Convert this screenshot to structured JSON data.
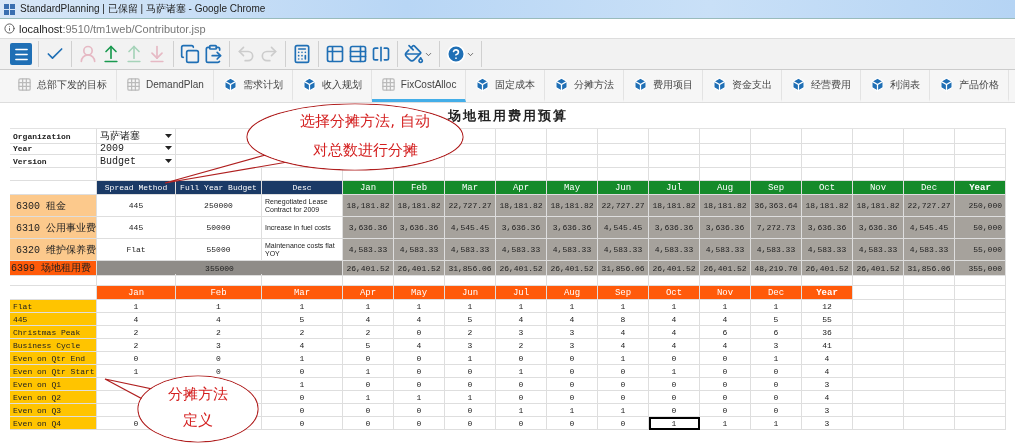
{
  "browser": {
    "title": "StandardPlanning | 已保留 | 马萨诸塞 - Google Chrome",
    "url_host": "localhost",
    "url_path": ":9510/tm1web/Contributor.jsp"
  },
  "toolbar": {
    "groups": [
      [
        {
          "kind": "menu",
          "disabled": false
        }
      ],
      [
        {
          "kind": "check",
          "disabled": false
        }
      ],
      [
        {
          "kind": "user",
          "disabled": true
        },
        {
          "kind": "upload",
          "disabled": false
        },
        {
          "kind": "upload",
          "disabled": true
        },
        {
          "kind": "download",
          "disabled": true
        }
      ],
      [
        {
          "kind": "copy",
          "disabled": false
        },
        {
          "kind": "paste",
          "disabled": false
        }
      ],
      [
        {
          "kind": "undo",
          "disabled": true
        },
        {
          "kind": "redo",
          "disabled": true
        }
      ],
      [
        {
          "kind": "calculator",
          "disabled": false
        }
      ],
      [
        {
          "kind": "table",
          "disabled": false
        },
        {
          "kind": "table-edit",
          "disabled": false
        },
        {
          "kind": "split",
          "disabled": false
        }
      ],
      [
        {
          "kind": "bucket",
          "disabled": false
        }
      ],
      [
        {
          "kind": "help",
          "disabled": false
        }
      ]
    ]
  },
  "tabs": [
    {
      "label": "总部下发的目标",
      "kind": "grid",
      "selected": false
    },
    {
      "label": "DemandPlan",
      "kind": "grid",
      "selected": false
    },
    {
      "label": "需求计划",
      "kind": "cube",
      "selected": false
    },
    {
      "label": "收入规划",
      "kind": "cube",
      "selected": false
    },
    {
      "label": "FixCostAlloc",
      "kind": "grid",
      "selected": true
    },
    {
      "label": "固定成本",
      "kind": "cube",
      "selected": false
    },
    {
      "label": "分摊方法",
      "kind": "cube",
      "selected": false
    },
    {
      "label": "费用项目",
      "kind": "cube",
      "selected": false
    },
    {
      "label": "资金支出",
      "kind": "cube",
      "selected": false
    },
    {
      "label": "经营费用",
      "kind": "cube",
      "selected": false
    },
    {
      "label": "利润表",
      "kind": "cube",
      "selected": false
    },
    {
      "label": "产品价格",
      "kind": "cube",
      "selected": false
    }
  ],
  "sheet": {
    "title": "场地租用费用预算",
    "filters": [
      {
        "label": "Organization",
        "value": "马萨诸塞"
      },
      {
        "label": "Year",
        "value": "2009"
      },
      {
        "label": "Version",
        "value": "Budget"
      }
    ],
    "budget_table": {
      "columns": [
        "Spread Method",
        "Full Year Budget",
        "Desc",
        "Jan",
        "Feb",
        "Mar",
        "Apr",
        "May",
        "Jun",
        "Jul",
        "Aug",
        "Sep",
        "Oct",
        "Nov",
        "Dec",
        "Year"
      ],
      "rows": [
        {
          "label": "6300 租金",
          "method": "445",
          "budget": "250000",
          "desc": "Renegotiated Lease Contract for 2009",
          "values": [
            "18,181.82",
            "18,181.82",
            "22,727.27",
            "18,181.82",
            "18,181.82",
            "22,727.27",
            "18,181.82",
            "18,181.82",
            "36,363.64",
            "18,181.82",
            "18,181.82",
            "22,727.27",
            "250,000"
          ]
        },
        {
          "label": "6310 公用事业费",
          "method": "445",
          "budget": "50000",
          "desc": "Increase in fuel costs",
          "values": [
            "3,636.36",
            "3,636.36",
            "4,545.45",
            "3,636.36",
            "3,636.36",
            "4,545.45",
            "3,636.36",
            "3,636.36",
            "7,272.73",
            "3,636.36",
            "3,636.36",
            "4,545.45",
            "50,000"
          ]
        },
        {
          "label": "6320 维护保养费",
          "method": "Flat",
          "budget": "55000",
          "desc": "Maintenance costs flat YOY",
          "values": [
            "4,583.33",
            "4,583.33",
            "4,583.33",
            "4,583.33",
            "4,583.33",
            "4,583.33",
            "4,583.33",
            "4,583.33",
            "4,583.33",
            "4,583.33",
            "4,583.33",
            "4,583.33",
            "55,000"
          ]
        }
      ],
      "total": {
        "label": "6399 场地租用费",
        "budget": "355000",
        "values": [
          "26,401.52",
          "26,401.52",
          "31,856.06",
          "26,401.52",
          "26,401.52",
          "31,856.06",
          "26,401.52",
          "26,401.52",
          "48,219.70",
          "26,401.52",
          "26,401.52",
          "31,856.06",
          "355,000"
        ]
      }
    },
    "spread_table": {
      "columns": [
        "Jan",
        "Feb",
        "Mar",
        "Apr",
        "May",
        "Jun",
        "Jul",
        "Aug",
        "Sep",
        "Oct",
        "Nov",
        "Dec",
        "Year"
      ],
      "rows": [
        {
          "label": "Flat",
          "cells": [
            {
              "text": "1",
              "selected": false
            },
            {
              "text": "1",
              "selected": false
            },
            {
              "text": "1",
              "selected": false
            },
            {
              "text": "1",
              "selected": false
            },
            {
              "text": "1",
              "selected": false
            },
            {
              "text": "1",
              "selected": false
            },
            {
              "text": "1",
              "selected": false
            },
            {
              "text": "1",
              "selected": false
            },
            {
              "text": "1",
              "selected": false
            },
            {
              "text": "1",
              "selected": false
            },
            {
              "text": "1",
              "selected": false
            },
            {
              "text": "1",
              "selected": false
            },
            {
              "text": "12",
              "selected": false
            }
          ]
        },
        {
          "label": "445",
          "cells": [
            {
              "text": "4",
              "selected": false
            },
            {
              "text": "4",
              "selected": false
            },
            {
              "text": "5",
              "selected": false
            },
            {
              "text": "4",
              "selected": false
            },
            {
              "text": "4",
              "selected": false
            },
            {
              "text": "5",
              "selected": false
            },
            {
              "text": "4",
              "selected": false
            },
            {
              "text": "4",
              "selected": false
            },
            {
              "text": "8",
              "selected": false
            },
            {
              "text": "4",
              "selected": false
            },
            {
              "text": "4",
              "selected": false
            },
            {
              "text": "5",
              "selected": false
            },
            {
              "text": "55",
              "selected": false
            }
          ]
        },
        {
          "label": "Christmas Peak",
          "cells": [
            {
              "text": "2",
              "selected": false
            },
            {
              "text": "2",
              "selected": false
            },
            {
              "text": "2",
              "selected": false
            },
            {
              "text": "2",
              "selected": false
            },
            {
              "text": "0",
              "selected": false
            },
            {
              "text": "2",
              "selected": false
            },
            {
              "text": "3",
              "selected": false
            },
            {
              "text": "3",
              "selected": false
            },
            {
              "text": "4",
              "selected": false
            },
            {
              "text": "4",
              "selected": false
            },
            {
              "text": "6",
              "selected": false
            },
            {
              "text": "6",
              "selected": false
            },
            {
              "text": "36",
              "selected": false
            }
          ]
        },
        {
          "label": "Business Cycle",
          "cells": [
            {
              "text": "2",
              "selected": false
            },
            {
              "text": "3",
              "selected": false
            },
            {
              "text": "4",
              "selected": false
            },
            {
              "text": "5",
              "selected": false
            },
            {
              "text": "4",
              "selected": false
            },
            {
              "text": "3",
              "selected": false
            },
            {
              "text": "2",
              "selected": false
            },
            {
              "text": "3",
              "selected": false
            },
            {
              "text": "4",
              "selected": false
            },
            {
              "text": "4",
              "selected": false
            },
            {
              "text": "4",
              "selected": false
            },
            {
              "text": "3",
              "selected": false
            },
            {
              "text": "41",
              "selected": false
            }
          ]
        },
        {
          "label": "Even on Qtr End",
          "cells": [
            {
              "text": "0",
              "selected": false
            },
            {
              "text": "0",
              "selected": false
            },
            {
              "text": "1",
              "selected": false
            },
            {
              "text": "0",
              "selected": false
            },
            {
              "text": "0",
              "selected": false
            },
            {
              "text": "1",
              "selected": false
            },
            {
              "text": "0",
              "selected": false
            },
            {
              "text": "0",
              "selected": false
            },
            {
              "text": "1",
              "selected": false
            },
            {
              "text": "0",
              "selected": false
            },
            {
              "text": "0",
              "selected": false
            },
            {
              "text": "1",
              "selected": false
            },
            {
              "text": "4",
              "selected": false
            }
          ]
        },
        {
          "label": "Even on Qtr Start",
          "cells": [
            {
              "text": "1",
              "selected": false
            },
            {
              "text": "0",
              "selected": false
            },
            {
              "text": "0",
              "selected": false
            },
            {
              "text": "1",
              "selected": false
            },
            {
              "text": "0",
              "selected": false
            },
            {
              "text": "0",
              "selected": false
            },
            {
              "text": "1",
              "selected": false
            },
            {
              "text": "0",
              "selected": false
            },
            {
              "text": "0",
              "selected": false
            },
            {
              "text": "1",
              "selected": false
            },
            {
              "text": "0",
              "selected": false
            },
            {
              "text": "0",
              "selected": false
            },
            {
              "text": "4",
              "selected": false
            }
          ]
        },
        {
          "label": "Even on Q1",
          "cells": [
            null,
            null,
            {
              "text": "1",
              "selected": false
            },
            {
              "text": "0",
              "selected": false
            },
            {
              "text": "0",
              "selected": false
            },
            {
              "text": "0",
              "selected": false
            },
            {
              "text": "0",
              "selected": false
            },
            {
              "text": "0",
              "selected": false
            },
            {
              "text": "0",
              "selected": false
            },
            {
              "text": "0",
              "selected": false
            },
            {
              "text": "0",
              "selected": false
            },
            {
              "text": "0",
              "selected": false
            },
            {
              "text": "3",
              "selected": false
            }
          ]
        },
        {
          "label": "Even on Q2",
          "cells": [
            null,
            null,
            {
              "text": "0",
              "selected": false
            },
            {
              "text": "1",
              "selected": false
            },
            {
              "text": "1",
              "selected": false
            },
            {
              "text": "1",
              "selected": false
            },
            {
              "text": "0",
              "selected": false
            },
            {
              "text": "0",
              "selected": false
            },
            {
              "text": "0",
              "selected": false
            },
            {
              "text": "0",
              "selected": false
            },
            {
              "text": "0",
              "selected": false
            },
            {
              "text": "0",
              "selected": false
            },
            {
              "text": "4",
              "selected": false
            }
          ]
        },
        {
          "label": "Even on Q3",
          "cells": [
            null,
            null,
            {
              "text": "0",
              "selected": false
            },
            {
              "text": "0",
              "selected": false
            },
            {
              "text": "0",
              "selected": false
            },
            {
              "text": "0",
              "selected": false
            },
            {
              "text": "1",
              "selected": false
            },
            {
              "text": "1",
              "selected": false
            },
            {
              "text": "1",
              "selected": false
            },
            {
              "text": "0",
              "selected": false
            },
            {
              "text": "0",
              "selected": false
            },
            {
              "text": "0",
              "selected": false
            },
            {
              "text": "3",
              "selected": false
            }
          ]
        },
        {
          "label": "Even on Q4",
          "cells": [
            {
              "text": "0",
              "selected": false
            },
            null,
            {
              "text": "0",
              "selected": false
            },
            {
              "text": "0",
              "selected": false
            },
            {
              "text": "0",
              "selected": false
            },
            {
              "text": "0",
              "selected": false
            },
            {
              "text": "0",
              "selected": false
            },
            {
              "text": "0",
              "selected": false
            },
            {
              "text": "0",
              "selected": false
            },
            {
              "text": "1",
              "selected": true
            },
            {
              "text": "1",
              "selected": false
            },
            {
              "text": "1",
              "selected": false
            },
            {
              "text": "3",
              "selected": false
            }
          ]
        }
      ]
    }
  },
  "callouts": [
    {
      "lines": [
        "选择分摊方法, 自动",
        "对总数进行分摊"
      ]
    },
    {
      "lines": [
        "分摊方法",
        "定义"
      ]
    }
  ]
}
